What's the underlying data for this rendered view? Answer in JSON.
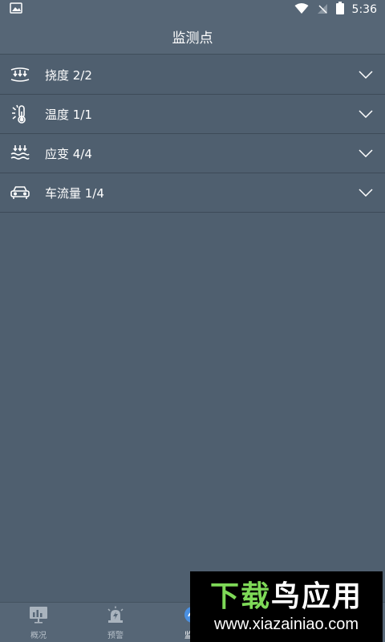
{
  "status_bar": {
    "time": "5:36"
  },
  "header": {
    "title": "监测点"
  },
  "list": {
    "items": [
      {
        "label": "挠度 2/2",
        "icon": "deflection-icon"
      },
      {
        "label": "温度 1/1",
        "icon": "thermometer-icon"
      },
      {
        "label": "应变 4/4",
        "icon": "strain-icon"
      },
      {
        "label": "车流量 1/4",
        "icon": "car-icon"
      }
    ]
  },
  "bottom_nav": {
    "items": [
      {
        "label": "概况",
        "icon": "chart-icon"
      },
      {
        "label": "预警",
        "icon": "alarm-icon"
      },
      {
        "label": "监测",
        "icon": "monitor-icon"
      }
    ],
    "active_index": 2
  },
  "watermark": {
    "title_part1": "下载",
    "title_part2": "鸟应用",
    "url": "www.xiazainiao.com"
  },
  "colors": {
    "background": "#4f5f6f",
    "header": "#566676",
    "accent": "#4a90e2",
    "watermark_green": "#7ed957"
  }
}
